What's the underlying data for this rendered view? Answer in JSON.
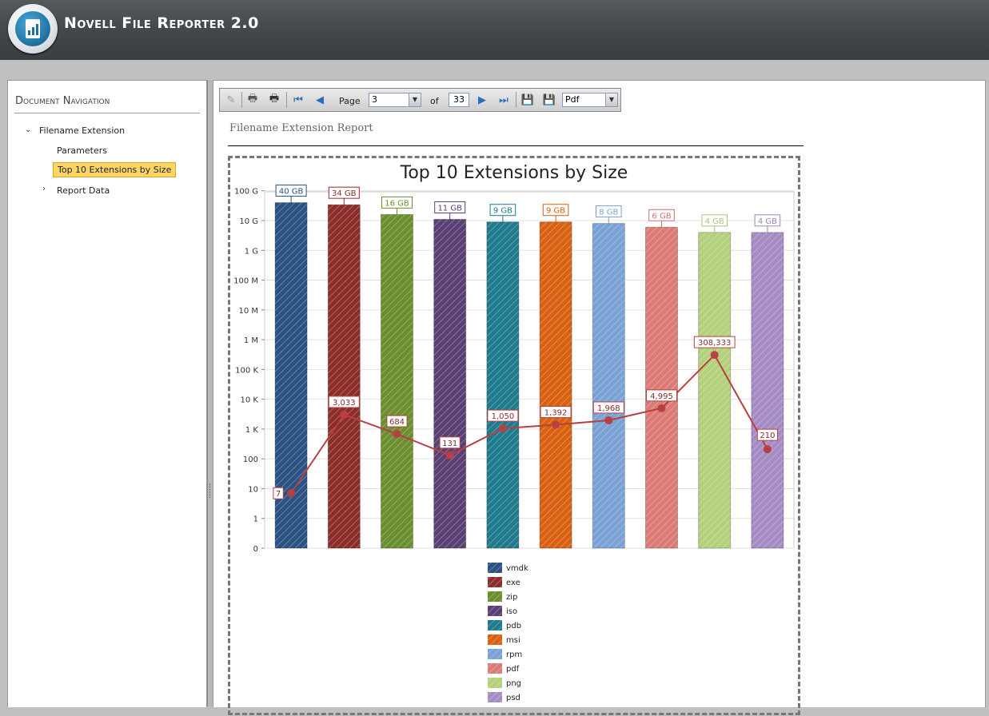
{
  "app": {
    "title": "Novell File Reporter 2.0"
  },
  "nav": {
    "title": "Document Navigation",
    "items": [
      {
        "label": "Filename Extension"
      },
      {
        "label": "Parameters"
      },
      {
        "label": "Top 10 Extensions by Size"
      },
      {
        "label": "Report Data"
      }
    ]
  },
  "toolbar": {
    "page_label": "Page",
    "page_value": "3",
    "of_label": "of",
    "total_pages": "33",
    "export_format": "Pdf"
  },
  "report": {
    "title": "Filename Extension Report"
  },
  "chart_data": {
    "type": "bar",
    "title": "Top 10 Extensions by Size",
    "y_scale": "log",
    "y_tick_labels": [
      "0",
      "1",
      "10",
      "100",
      "1 K",
      "10 K",
      "100 K",
      "1 M",
      "10 M",
      "100 M",
      "1 G",
      "10 G",
      "100 G"
    ],
    "grid": true,
    "legend_position": "bottom",
    "categories": [
      "vmdk",
      "exe",
      "zip",
      "iso",
      "pdb",
      "msi",
      "rpm",
      "pdf",
      "png",
      "psd"
    ],
    "colors": [
      "#2b5283",
      "#8c2d2a",
      "#6b8e2e",
      "#5a3f74",
      "#1f7a8c",
      "#d86010",
      "#7aa2d4",
      "#dc7a76",
      "#b3d17a",
      "#a58cc4"
    ],
    "label_colors": [
      "#2b5283",
      "#8c2d2a",
      "#6b8e2e",
      "#5a3f74",
      "#1f7a8c",
      "#d86010",
      "#7aa2d4",
      "#c87270",
      "#a8c77a",
      "#9a85b8"
    ],
    "series": [
      {
        "values": [
          40000000000,
          34000000000,
          16000000000,
          11000000000,
          9000000000,
          9000000000,
          8000000000,
          6000000000,
          4000000000,
          4000000000
        ],
        "labels": [
          "40 GB",
          "34 GB",
          "16 GB",
          "11 GB",
          "9 GB",
          "9 GB",
          "8 GB",
          "6 GB",
          "4 GB",
          "4 GB"
        ]
      },
      {
        "type": "line",
        "color": "#b84040",
        "values": [
          7,
          3033,
          684,
          131,
          1050,
          1392,
          1968,
          4995,
          308333,
          210
        ],
        "labels": [
          "7",
          "3,033",
          "684",
          "131",
          "1,050",
          "1,392",
          "1,968",
          "4,995",
          "308,333",
          "210"
        ]
      }
    ]
  }
}
